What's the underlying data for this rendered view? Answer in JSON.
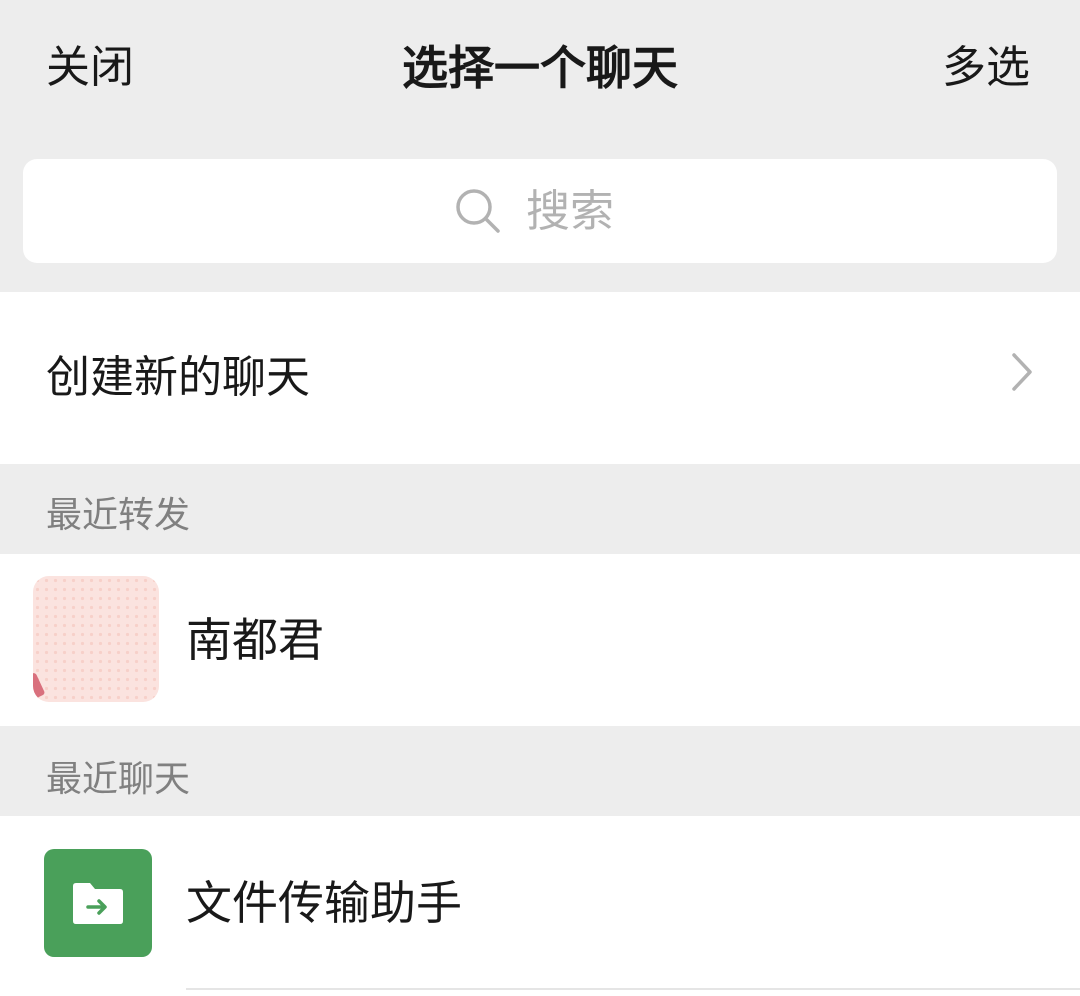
{
  "header": {
    "close_label": "关闭",
    "title": "选择一个聊天",
    "multi_select_label": "多选"
  },
  "search": {
    "placeholder": "搜索",
    "icon": "search-icon"
  },
  "create_chat": {
    "label": "创建新的聊天",
    "icon": "chevron-right-icon"
  },
  "sections": {
    "recent_forward": {
      "title": "最近转发",
      "items": [
        {
          "name": "南都君",
          "avatar": "pink-dotted-avatar"
        }
      ]
    },
    "recent_chats": {
      "title": "最近聊天",
      "items": [
        {
          "name": "文件传输助手",
          "avatar": "file-transfer-icon"
        }
      ]
    }
  },
  "colors": {
    "background": "#ededed",
    "row_background": "#ffffff",
    "text_primary": "#191919",
    "text_secondary": "#808080",
    "placeholder": "#b2b2b2",
    "file_transfer_green": "#4aa05a"
  }
}
